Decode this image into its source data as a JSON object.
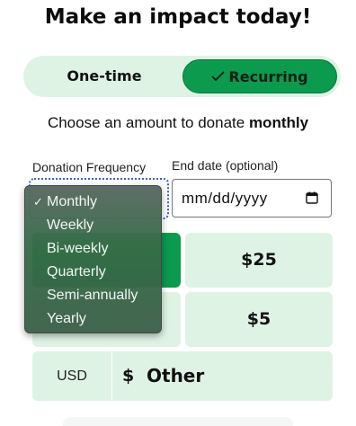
{
  "title": "Make an impact today!",
  "toggle": {
    "one_time_label": "One-time",
    "recurring_label": "Recurring",
    "selected": "Recurring"
  },
  "subtitle": {
    "prefix": "Choose an amount to donate ",
    "emphasis": "monthly"
  },
  "frequency": {
    "label": "Donation Frequency",
    "options": [
      "Monthly",
      "Weekly",
      "Bi-weekly",
      "Quarterly",
      "Semi-annually",
      "Yearly"
    ],
    "selected_index": 0,
    "check_glyph": "✓"
  },
  "end_date": {
    "label": "End date (optional)",
    "placeholder": "mm/dd/yyyy",
    "icon": "calendar-icon"
  },
  "amounts": {
    "selected_tile": "",
    "tile_25": "$25",
    "tile_left2": "",
    "tile_5": "$5"
  },
  "other": {
    "currency": "USD",
    "symbol": "$",
    "label": "Other"
  },
  "colors": {
    "accent_green": "#0b9a4e",
    "tile_bg": "#dff3e4",
    "focus_ring": "#3b5bdb"
  }
}
